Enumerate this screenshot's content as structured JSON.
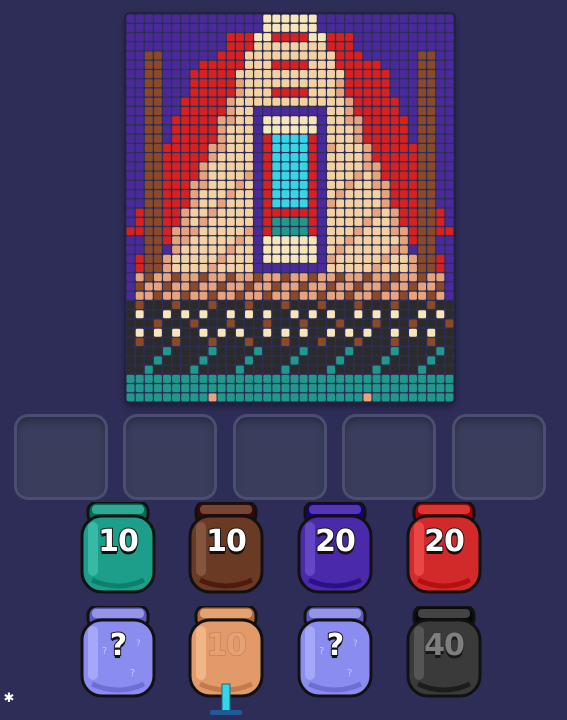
{
  "game": {
    "title": "",
    "board": {
      "description_colors": {
        "purple": "#4a2a9a",
        "red": "#d8201e",
        "beige": "#f3d2a0",
        "tan": "#e7a47a",
        "brown": "#8a4a28",
        "teal": "#1f9a8a",
        "cyan": "#36d6e6",
        "black": "#2b2b2b",
        "cream": "#f6e6b8"
      }
    },
    "slots": [
      {
        "state": "empty"
      },
      {
        "state": "empty"
      },
      {
        "state": "empty"
      },
      {
        "state": "empty"
      },
      {
        "state": "empty"
      }
    ],
    "jars_row1": [
      {
        "color": "teal",
        "hex": "#1c9e8a",
        "count": "10"
      },
      {
        "color": "brown",
        "hex": "#6b3a24",
        "count": "10"
      },
      {
        "color": "purple",
        "hex": "#4a2aa8",
        "count": "20"
      },
      {
        "color": "red",
        "hex": "#d22a2a",
        "count": "20"
      }
    ],
    "jars_row2": [
      {
        "color": "mystery",
        "hex": "#8a8cf0",
        "count": "?"
      },
      {
        "color": "tan",
        "hex": "#e29a6a",
        "count": "10",
        "locked": true
      },
      {
        "color": "mystery",
        "hex": "#8a8cf0",
        "count": "?"
      },
      {
        "color": "black",
        "hex": "#3a3a3a",
        "count": "40",
        "dimmed": true
      }
    ],
    "settings_icon": "gear-icon"
  }
}
